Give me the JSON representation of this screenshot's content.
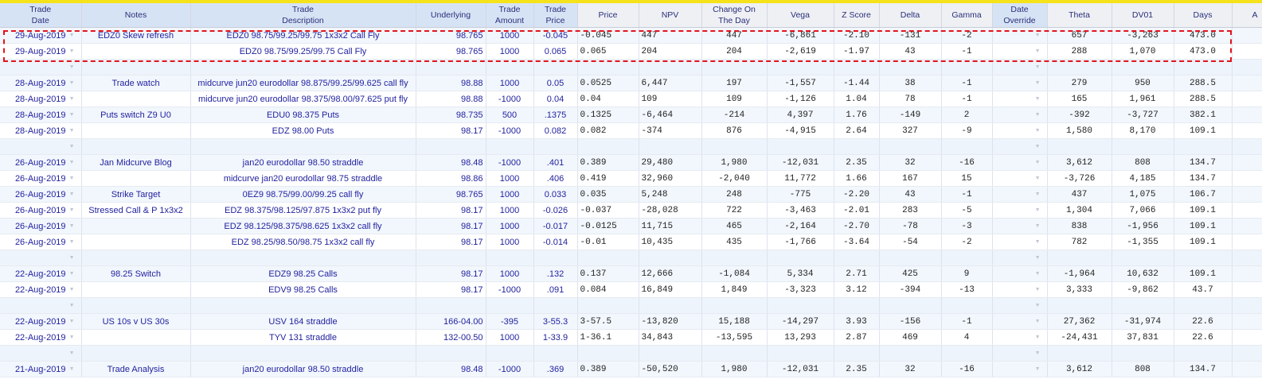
{
  "headers": [
    {
      "line1": "Trade",
      "line2": "Date"
    },
    {
      "line1": "Notes",
      "line2": ""
    },
    {
      "line1": "Trade",
      "line2": "Description"
    },
    {
      "line1": "Underlying",
      "line2": ""
    },
    {
      "line1": "Trade",
      "line2": "Amount"
    },
    {
      "line1": "Trade",
      "line2": "Price"
    },
    {
      "line1": "Price",
      "line2": ""
    },
    {
      "line1": "NPV",
      "line2": ""
    },
    {
      "line1": "Change On",
      "line2": "The Day"
    },
    {
      "line1": "Vega",
      "line2": ""
    },
    {
      "line1": "Z Score",
      "line2": ""
    },
    {
      "line1": "Delta",
      "line2": ""
    },
    {
      "line1": "Gamma",
      "line2": ""
    },
    {
      "line1": "Date",
      "line2": "Override"
    },
    {
      "line1": "Theta",
      "line2": ""
    },
    {
      "line1": "DV01",
      "line2": ""
    },
    {
      "line1": "Days",
      "line2": ""
    },
    {
      "line1": "A",
      "line2": ""
    }
  ],
  "rows": [
    {
      "date": "29-Aug-2019",
      "notes": "EDZ0 Skew refresh",
      "desc": "EDZ0 98.75/99.25/99.75 1x3x2 Call Fly",
      "und": "98.765",
      "amt": "1000",
      "tprice": "-0.045",
      "price": "-0.045",
      "npv": "447",
      "chg": "447",
      "vega": "-6,861",
      "z": "-2.10",
      "delta": "-131",
      "gamma": "-2",
      "theta": "657",
      "dv01": "-3,263",
      "days": "473.0"
    },
    {
      "date": "29-Aug-2019",
      "notes": "",
      "desc": "EDZ0 98.75/99.25/99.75 Call Fly",
      "und": "98.765",
      "amt": "1000",
      "tprice": "0.065",
      "price": "0.065",
      "npv": "204",
      "chg": "204",
      "vega": "-2,619",
      "z": "-1.97",
      "delta": "43",
      "gamma": "-1",
      "theta": "288",
      "dv01": "1,070",
      "days": "473.0"
    },
    {
      "blank": true
    },
    {
      "date": "28-Aug-2019",
      "notes": "Trade watch",
      "desc": "midcurve jun20 eurodollar 98.875/99.25/99.625 call fly",
      "und": "98.88",
      "amt": "1000",
      "tprice": "0.05",
      "price": "0.0525",
      "npv": "6,447",
      "chg": "197",
      "vega": "-1,557",
      "z": "-1.44",
      "delta": "38",
      "gamma": "-1",
      "theta": "279",
      "dv01": "950",
      "days": "288.5"
    },
    {
      "date": "28-Aug-2019",
      "notes": "",
      "desc": "midcurve jun20 eurodollar 98.375/98.00/97.625 put fly",
      "und": "98.88",
      "amt": "-1000",
      "tprice": "0.04",
      "price": "0.04",
      "npv": "109",
      "chg": "109",
      "vega": "-1,126",
      "z": "1.04",
      "delta": "78",
      "gamma": "-1",
      "theta": "165",
      "dv01": "1,961",
      "days": "288.5"
    },
    {
      "date": "28-Aug-2019",
      "notes": "Puts switch Z9 U0",
      "desc": "EDU0 98.375 Puts",
      "und": "98.735",
      "amt": "500",
      "tprice": ".1375",
      "price": "0.1325",
      "npv": "-6,464",
      "chg": "-214",
      "vega": "4,397",
      "z": "1.76",
      "delta": "-149",
      "gamma": "2",
      "theta": "-392",
      "dv01": "-3,727",
      "days": "382.1"
    },
    {
      "date": "28-Aug-2019",
      "notes": "",
      "desc": "EDZ 98.00 Puts",
      "und": "98.17",
      "amt": "-1000",
      "tprice": "0.082",
      "price": "0.082",
      "npv": "-374",
      "chg": "876",
      "vega": "-4,915",
      "z": "2.64",
      "delta": "327",
      "gamma": "-9",
      "theta": "1,580",
      "dv01": "8,170",
      "days": "109.1"
    },
    {
      "blank": true
    },
    {
      "date": "26-Aug-2019",
      "notes": "Jan Midcurve Blog",
      "desc": "jan20 eurodollar 98.50 straddle",
      "und": "98.48",
      "amt": "-1000",
      "tprice": ".401",
      "price": "0.389",
      "npv": "29,480",
      "chg": "1,980",
      "vega": "-12,031",
      "z": "2.35",
      "delta": "32",
      "gamma": "-16",
      "theta": "3,612",
      "dv01": "808",
      "days": "134.7"
    },
    {
      "date": "26-Aug-2019",
      "notes": "",
      "desc": "midcurve jan20 eurodollar 98.75 straddle",
      "und": "98.86",
      "amt": "1000",
      "tprice": ".406",
      "price": "0.419",
      "npv": "32,960",
      "chg": "-2,040",
      "vega": "11,772",
      "z": "1.66",
      "delta": "167",
      "gamma": "15",
      "theta": "-3,726",
      "dv01": "4,185",
      "days": "134.7"
    },
    {
      "date": "26-Aug-2019",
      "notes": "Strike Target",
      "desc": "0EZ9 98.75/99.00/99.25 call fly",
      "und": "98.765",
      "amt": "1000",
      "tprice": "0.033",
      "price": "0.035",
      "npv": "5,248",
      "chg": "248",
      "vega": "-775",
      "z": "-2.20",
      "delta": "43",
      "gamma": "-1",
      "theta": "437",
      "dv01": "1,075",
      "days": "106.7"
    },
    {
      "date": "26-Aug-2019",
      "notes": "Stressed Call & P 1x3x2",
      "desc": "EDZ 98.375/98.125/97.875 1x3x2 put fly",
      "und": "98.17",
      "amt": "1000",
      "tprice": "-0.026",
      "price": "-0.037",
      "npv": "-28,028",
      "chg": "722",
      "vega": "-3,463",
      "z": "-2.01",
      "delta": "283",
      "gamma": "-5",
      "theta": "1,304",
      "dv01": "7,066",
      "days": "109.1"
    },
    {
      "date": "26-Aug-2019",
      "notes": "",
      "desc": "EDZ 98.125/98.375/98.625 1x3x2 call fly",
      "und": "98.17",
      "amt": "1000",
      "tprice": "-0.017",
      "price": "-0.0125",
      "npv": "11,715",
      "chg": "465",
      "vega": "-2,164",
      "z": "-2.70",
      "delta": "-78",
      "gamma": "-3",
      "theta": "838",
      "dv01": "-1,956",
      "days": "109.1"
    },
    {
      "date": "26-Aug-2019",
      "notes": "",
      "desc": "EDZ 98.25/98.50/98.75 1x3x2 call fly",
      "und": "98.17",
      "amt": "1000",
      "tprice": "-0.014",
      "price": "-0.01",
      "npv": "10,435",
      "chg": "435",
      "vega": "-1,766",
      "z": "-3.64",
      "delta": "-54",
      "gamma": "-2",
      "theta": "782",
      "dv01": "-1,355",
      "days": "109.1"
    },
    {
      "blank": true
    },
    {
      "date": "22-Aug-2019",
      "notes": "98.25 Switch",
      "desc": "EDZ9 98.25 Calls",
      "und": "98.17",
      "amt": "1000",
      "tprice": ".132",
      "price": "0.137",
      "npv": "12,666",
      "chg": "-1,084",
      "vega": "5,334",
      "z": "2.71",
      "delta": "425",
      "gamma": "9",
      "theta": "-1,964",
      "dv01": "10,632",
      "days": "109.1"
    },
    {
      "date": "22-Aug-2019",
      "notes": "",
      "desc": "EDV9 98.25 Calls",
      "und": "98.17",
      "amt": "-1000",
      "tprice": ".091",
      "price": "0.084",
      "npv": "16,849",
      "chg": "1,849",
      "vega": "-3,323",
      "z": "3.12",
      "delta": "-394",
      "gamma": "-13",
      "theta": "3,333",
      "dv01": "-9,862",
      "days": "43.7"
    },
    {
      "blank": true
    },
    {
      "date": "22-Aug-2019",
      "notes": "US 10s v US 30s",
      "desc": "USV 164 straddle",
      "und": "166-04.00",
      "amt": "-395",
      "tprice": "3-55.3",
      "price": "3-57.5",
      "npv": "-13,820",
      "chg": "15,188",
      "vega": "-14,297",
      "z": "3.93",
      "delta": "-156",
      "gamma": "-1",
      "theta": "27,362",
      "dv01": "-31,974",
      "days": "22.6"
    },
    {
      "date": "22-Aug-2019",
      "notes": "",
      "desc": "TYV 131 straddle",
      "und": "132-00.50",
      "amt": "1000",
      "tprice": "1-33.9",
      "price": "1-36.1",
      "npv": "34,843",
      "chg": "-13,595",
      "vega": "13,293",
      "z": "2.87",
      "delta": "469",
      "gamma": "4",
      "theta": "-24,431",
      "dv01": "37,831",
      "days": "22.6"
    },
    {
      "blank": true
    },
    {
      "date": "21-Aug-2019",
      "notes": "Trade Analysis",
      "desc": "jan20 eurodollar 98.50 straddle",
      "und": "98.48",
      "amt": "-1000",
      "tprice": ".369",
      "price": "0.389",
      "npv": "-50,520",
      "chg": "1,980",
      "vega": "-12,031",
      "z": "2.35",
      "delta": "32",
      "gamma": "-16",
      "theta": "3,612",
      "dv01": "808",
      "days": "134.7"
    }
  ]
}
